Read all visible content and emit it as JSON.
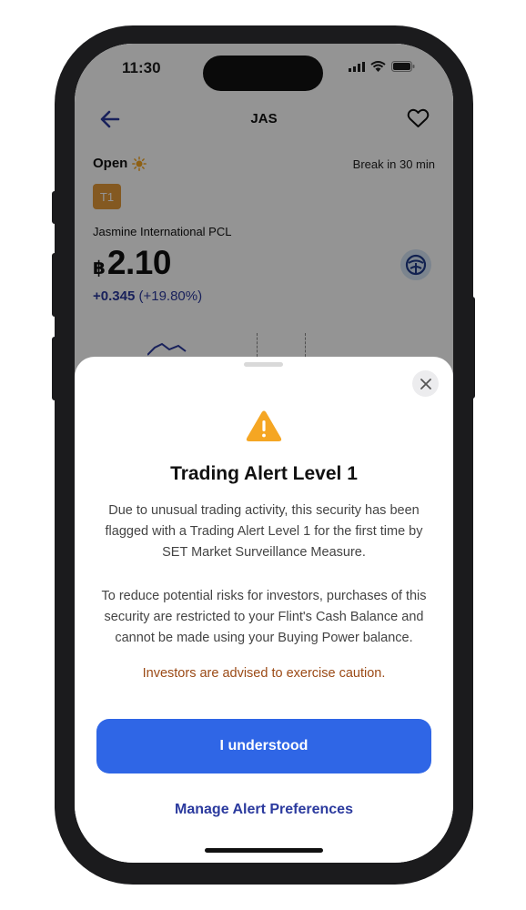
{
  "status_bar": {
    "time": "11:30"
  },
  "header": {
    "title": "JAS"
  },
  "market": {
    "status": "Open",
    "break_text": "Break in 30 min"
  },
  "stock": {
    "badge": "T1",
    "company": "Jasmine International PCL",
    "currency": "฿",
    "price": "2.10",
    "change": "+0.345",
    "change_pct": "(+19.80%)"
  },
  "alert": {
    "title": "Trading Alert Level 1",
    "paragraph1": "Due to unusual trading activity, this security has been flagged with a Trading Alert Level 1 for the first time by SET Market Surveillance Measure.",
    "paragraph2": "To reduce potential risks for investors, purchases of this security are restricted to your Flint's Cash Balance and cannot be made using your Buying Power balance.",
    "caution": "Investors are advised to exercise caution.",
    "primary_button": "I understood",
    "secondary_link": "Manage Alert Preferences"
  },
  "colors": {
    "primary": "#2f66e6",
    "link": "#2b3a9e",
    "warning": "#f5a623",
    "caution_text": "#9b4a16",
    "badge": "#e39a3a"
  },
  "icons": [
    "back-arrow-icon",
    "heart-icon",
    "sun-icon",
    "close-icon",
    "warning-icon",
    "signal-icon",
    "wifi-icon",
    "battery-icon"
  ]
}
